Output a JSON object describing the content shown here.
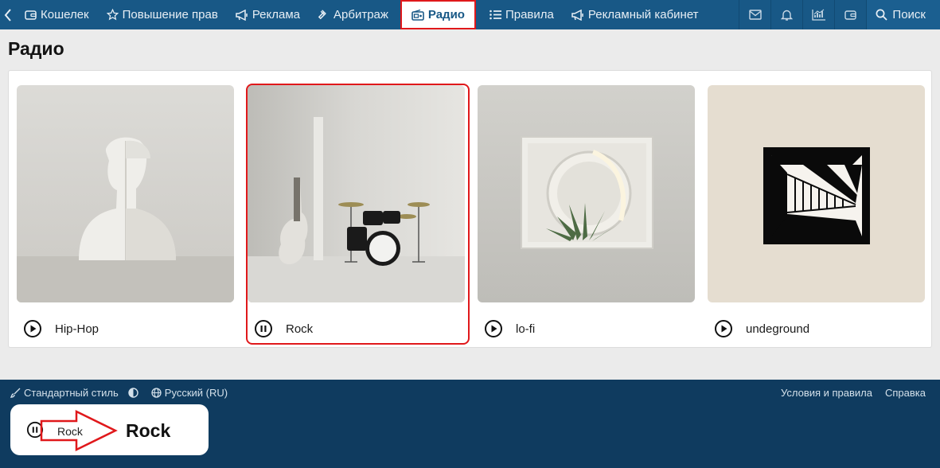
{
  "nav": {
    "items": [
      {
        "label": "Кошелек",
        "icon": "wallet-icon"
      },
      {
        "label": "Повышение прав",
        "icon": "star-icon"
      },
      {
        "label": "Реклама",
        "icon": "megaphone-icon"
      },
      {
        "label": "Арбитраж",
        "icon": "gavel-icon"
      },
      {
        "label": "Радио",
        "icon": "radio-icon",
        "active": true
      },
      {
        "label": "Правила",
        "icon": "list-icon"
      },
      {
        "label": "Рекламный кабинет",
        "icon": "megaphone-icon"
      }
    ],
    "right_icons": [
      "mail-icon",
      "bell-icon",
      "chart-icon",
      "wallet-icon"
    ],
    "search_label": "Поиск"
  },
  "page": {
    "title": "Радио"
  },
  "stations": [
    {
      "name": "Hip-Hop",
      "state": "play"
    },
    {
      "name": "Rock",
      "state": "pause",
      "highlighted": true
    },
    {
      "name": "lo-fi",
      "state": "play"
    },
    {
      "name": "undeground",
      "state": "play"
    }
  ],
  "footer": {
    "style_label": "Стандартный стиль",
    "language_label": "Русский (RU)",
    "links": [
      "Условия и правила",
      "Справка"
    ]
  },
  "player": {
    "station_label": "Rock",
    "now_playing": "Rock",
    "state": "pause"
  },
  "colors": {
    "nav_bg": "#185886",
    "footer_bg": "#0f3b5f",
    "highlight": "#e0181b"
  }
}
